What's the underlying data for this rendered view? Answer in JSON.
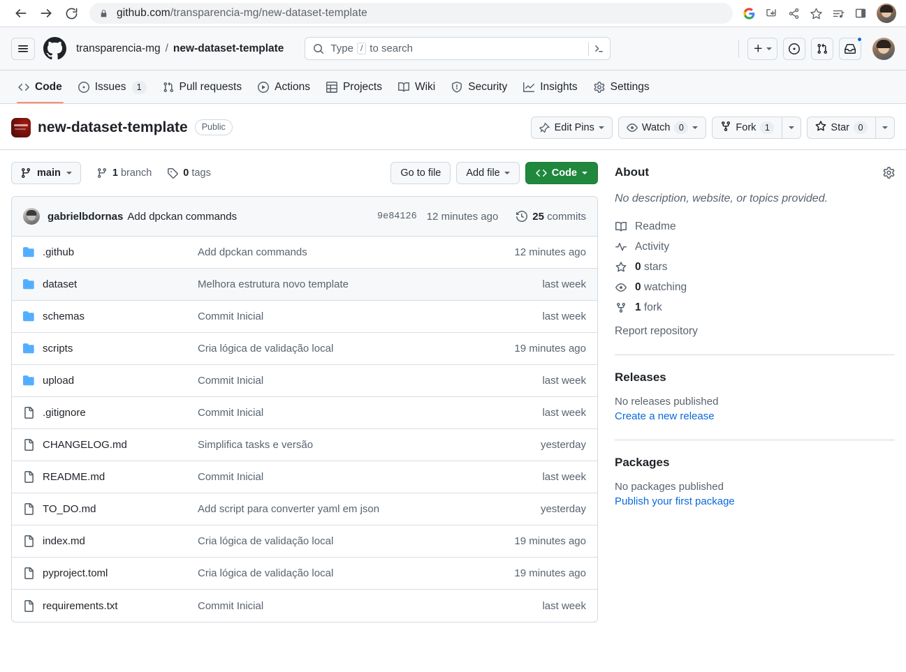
{
  "browser": {
    "url_host": "github.com",
    "url_path": "/transparencia-mg/new-dataset-template",
    "back_icon": "back-arrow-icon",
    "forward_icon": "forward-arrow-icon",
    "reload_icon": "reload-icon",
    "lock_icon": "lock-icon",
    "actions": [
      "google-icon",
      "install-app-icon",
      "share-icon",
      "bookmark-star-icon",
      "media-playlist-icon",
      "side-panel-icon",
      "browser-profile-avatar"
    ]
  },
  "header": {
    "menu_icon": "hamburger-menu-icon",
    "logo_icon": "github-mark-icon",
    "owner": "transparencia-mg",
    "separator": "/",
    "repo": "new-dataset-template",
    "search": {
      "placeholder": "Type",
      "placeholder_suffix": "to search",
      "slash_key": "/",
      "search_icon": "search-icon",
      "terminal_icon": "terminal-icon"
    },
    "buttons": [
      {
        "name": "create-new-button",
        "icon": "plus-icon"
      },
      {
        "name": "issues-button",
        "icon": "issue-opened-icon"
      },
      {
        "name": "pull-requests-button",
        "icon": "git-pull-request-icon"
      },
      {
        "name": "notifications-button",
        "icon": "inbox-icon",
        "has_dot": true
      }
    ],
    "avatar": "user-avatar"
  },
  "repo_nav": {
    "tabs": [
      {
        "label": "Code",
        "icon": "code-icon",
        "active": true,
        "count": null
      },
      {
        "label": "Issues",
        "icon": "issue-opened-icon",
        "active": false,
        "count": "1"
      },
      {
        "label": "Pull requests",
        "icon": "git-pull-request-icon",
        "active": false,
        "count": null
      },
      {
        "label": "Actions",
        "icon": "play-circle-icon",
        "active": false,
        "count": null
      },
      {
        "label": "Projects",
        "icon": "table-icon",
        "active": false,
        "count": null
      },
      {
        "label": "Wiki",
        "icon": "book-icon",
        "active": false,
        "count": null
      },
      {
        "label": "Security",
        "icon": "shield-icon",
        "active": false,
        "count": null
      },
      {
        "label": "Insights",
        "icon": "graph-icon",
        "active": false,
        "count": null
      },
      {
        "label": "Settings",
        "icon": "gear-icon",
        "active": false,
        "count": null
      }
    ]
  },
  "title_row": {
    "avatar": "repo-avatar-image",
    "repo_name": "new-dataset-template",
    "visibility": "Public",
    "edit_pins": {
      "label": "Edit Pins",
      "icon": "pin-icon"
    },
    "watch": {
      "label": "Watch",
      "count": "0",
      "icon": "eye-icon"
    },
    "fork": {
      "label": "Fork",
      "count": "1",
      "icon": "repo-forked-icon",
      "highlighted": true
    },
    "star": {
      "label": "Star",
      "count": "0",
      "icon": "star-icon"
    },
    "highlight_color": "#ff0000"
  },
  "branch_row": {
    "branch": "main",
    "branch_icon": "git-branch-icon",
    "branches_count": "1",
    "branches_label": "branch",
    "tags_count": "0",
    "tags_label": "tags",
    "tag_icon": "tag-icon",
    "go_to_file": "Go to file",
    "add_file": "Add file",
    "code_button": "Code",
    "code_icon": "code-icon"
  },
  "commit_bar": {
    "author": "gabrielbdornas",
    "message": "Add dpckan commands",
    "hash": "9e84126",
    "time": "12 minutes ago",
    "commits_count": "25",
    "commits_label": "commits",
    "history_icon": "history-icon"
  },
  "files": [
    {
      "type": "folder",
      "name": ".github",
      "message": "Add dpckan commands",
      "time": "12 minutes ago",
      "highlighted": false
    },
    {
      "type": "folder",
      "name": "dataset",
      "message": "Melhora estrutura novo template",
      "time": "last week",
      "highlighted": true
    },
    {
      "type": "folder",
      "name": "schemas",
      "message": "Commit Inicial",
      "time": "last week",
      "highlighted": false
    },
    {
      "type": "folder",
      "name": "scripts",
      "message": "Cria lógica de validação local",
      "time": "19 minutes ago",
      "highlighted": false
    },
    {
      "type": "folder",
      "name": "upload",
      "message": "Commit Inicial",
      "time": "last week",
      "highlighted": false
    },
    {
      "type": "file",
      "name": ".gitignore",
      "message": "Commit Inicial",
      "time": "last week",
      "highlighted": false
    },
    {
      "type": "file",
      "name": "CHANGELOG.md",
      "message": "Simplifica tasks e versão",
      "time": "yesterday",
      "highlighted": false
    },
    {
      "type": "file",
      "name": "README.md",
      "message": "Commit Inicial",
      "time": "last week",
      "highlighted": false
    },
    {
      "type": "file",
      "name": "TO_DO.md",
      "message": "Add script para converter yaml em json",
      "time": "yesterday",
      "highlighted": false
    },
    {
      "type": "file",
      "name": "index.md",
      "message": "Cria lógica de validação local",
      "time": "19 minutes ago",
      "highlighted": false
    },
    {
      "type": "file",
      "name": "pyproject.toml",
      "message": "Cria lógica de validação local",
      "time": "19 minutes ago",
      "highlighted": false
    },
    {
      "type": "file",
      "name": "requirements.txt",
      "message": "Commit Inicial",
      "time": "last week",
      "highlighted": false
    }
  ],
  "sidebar": {
    "about_title": "About",
    "about_gear": "gear-icon",
    "description": "No description, website, or topics provided.",
    "links": [
      {
        "label": "Readme",
        "icon": "book-icon",
        "bold": null
      },
      {
        "label": "Activity",
        "icon": "pulse-icon",
        "bold": null
      },
      {
        "label": "stars",
        "icon": "star-icon",
        "bold": "0"
      },
      {
        "label": "watching",
        "icon": "eye-icon",
        "bold": "0"
      },
      {
        "label": "fork",
        "icon": "repo-forked-icon",
        "bold": "1"
      }
    ],
    "report": "Report repository",
    "releases_title": "Releases",
    "releases_empty": "No releases published",
    "releases_link": "Create a new release",
    "packages_title": "Packages",
    "packages_empty": "No packages published",
    "packages_link": "Publish your first package"
  }
}
